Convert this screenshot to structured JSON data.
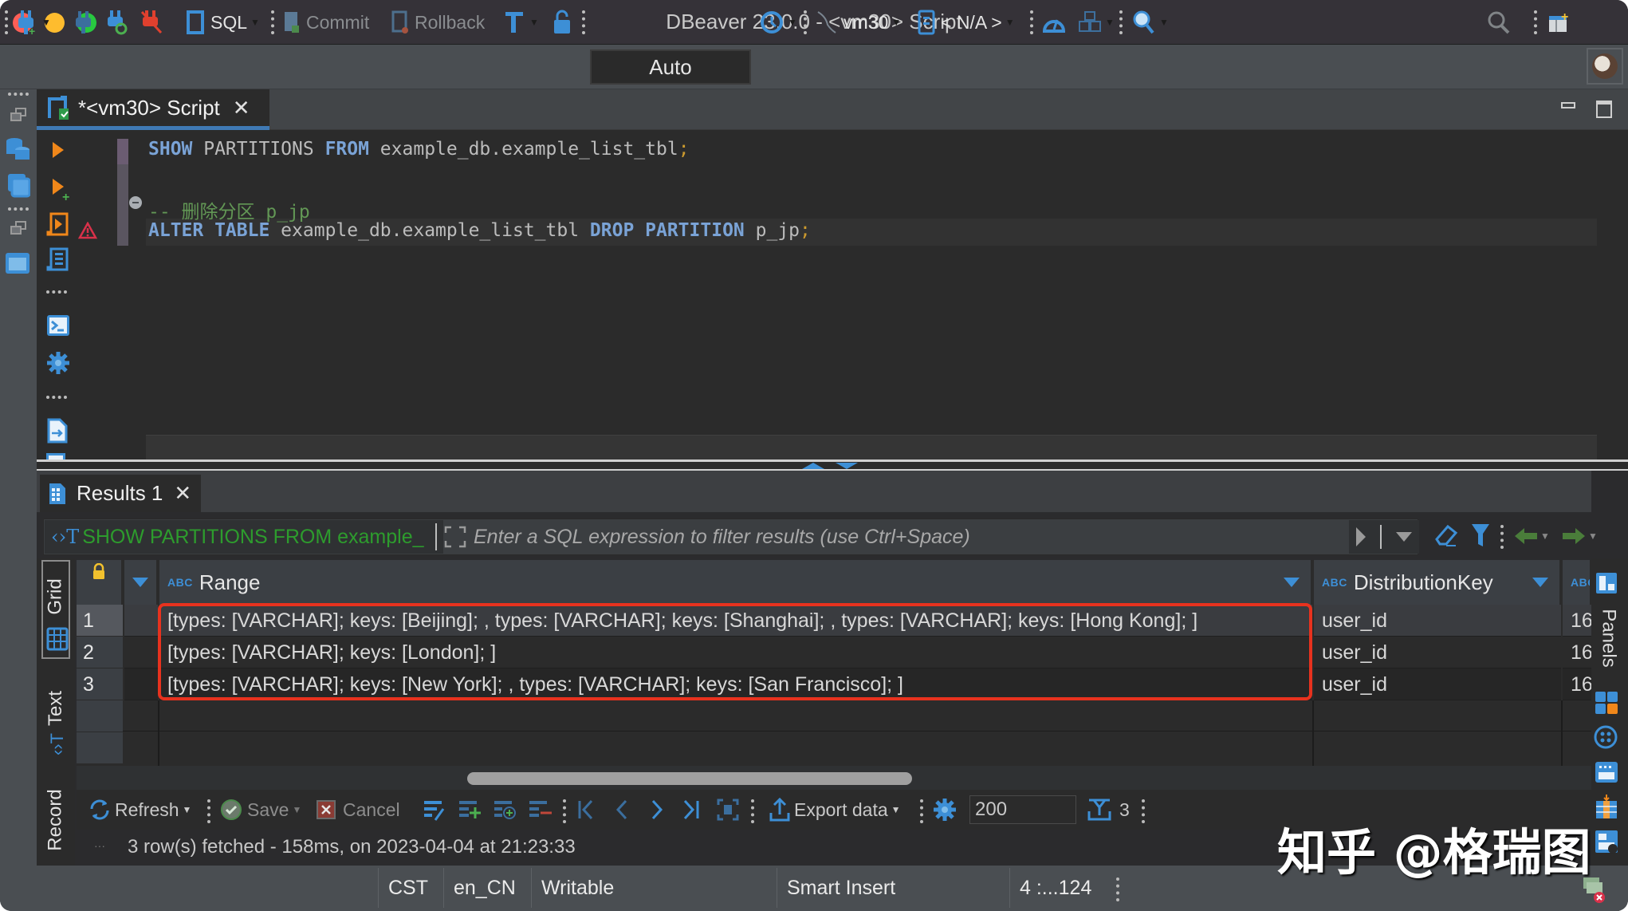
{
  "window": {
    "title": "DBeaver 23.0.0 - <vm30> Script"
  },
  "toolbar": {
    "sql_label": "SQL",
    "commit_label": "Commit",
    "rollback_label": "Rollback",
    "transaction_mode": "Auto",
    "connection": "vm30",
    "schema": "< N/A >"
  },
  "editor": {
    "tab_label": "*<vm30> Script",
    "lines": [
      {
        "kw1": "SHOW",
        "t1": " PARTITIONS ",
        "kw2": "FROM",
        "t2": " example_db.example_list_tbl",
        "end": ";"
      },
      {
        "comment": "-- 删除分区 p_jp"
      },
      {
        "kw1": "ALTER TABLE",
        "t1": " example_db.example_list_tbl ",
        "kw2": "DROP PARTITION",
        "t2": " p_jp",
        "end": ";"
      }
    ]
  },
  "results": {
    "tab_label": "Results 1",
    "filter_query": "SHOW PARTITIONS FROM example_",
    "filter_placeholder": "Enter a SQL expression to filter results (use Ctrl+Space)",
    "view_tabs": [
      "Grid",
      "Text",
      "Record"
    ],
    "columns": [
      {
        "type": "ABC",
        "name": "Range"
      },
      {
        "type": "ABC",
        "name": "DistributionKey"
      },
      {
        "type": "ABC",
        "name": ""
      }
    ],
    "rows": [
      {
        "num": "1",
        "range": "[types: [VARCHAR]; keys: [Beijing]; , types: [VARCHAR]; keys: [Shanghai]; , types: [VARCHAR]; keys: [Hong Kong]; ]",
        "dist_key": "user_id",
        "next": "16"
      },
      {
        "num": "2",
        "range": "[types: [VARCHAR]; keys: [London]; ]",
        "dist_key": "user_id",
        "next": "16"
      },
      {
        "num": "3",
        "range": "[types: [VARCHAR]; keys: [New York]; , types: [VARCHAR]; keys: [San Francisco]; ]",
        "dist_key": "user_id",
        "next": "16"
      }
    ],
    "bottom_toolbar": {
      "refresh": "Refresh",
      "save": "Save",
      "cancel": "Cancel",
      "export": "Export data",
      "fetch_size": "200",
      "row_count": "3"
    },
    "status_message": "3 row(s) fetched - 158ms, on 2023-04-04 at 21:23:33",
    "panels_label": "Panels"
  },
  "statusbar": {
    "timezone": "CST",
    "locale": "en_CN",
    "mode": "Writable",
    "insert_mode": "Smart Insert",
    "position": "4 :...124"
  },
  "watermark": "知乎 @格瑞图",
  "colors": {
    "accent": "#3d8fd6",
    "highlight_border": "#e8321e",
    "keyword": "#7aa3d6",
    "comment": "#629755"
  }
}
